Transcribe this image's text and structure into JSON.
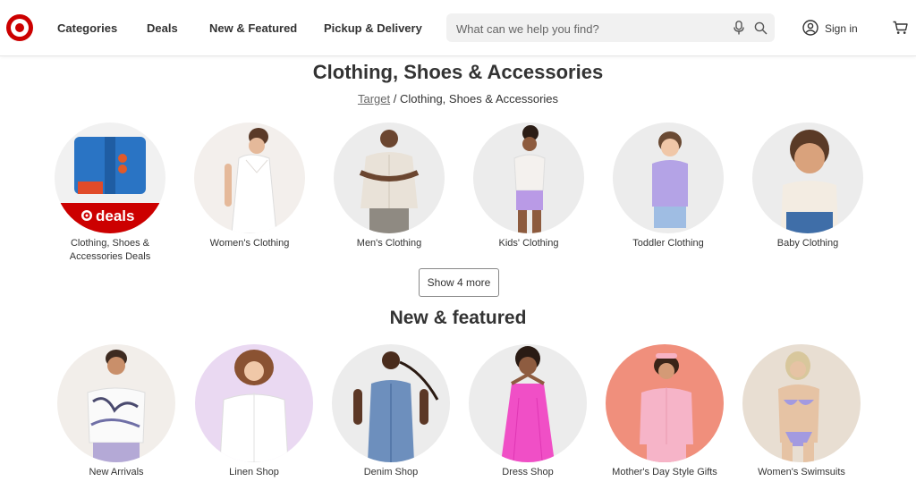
{
  "header": {
    "nav": [
      "Categories",
      "Deals",
      "New & Featured",
      "Pickup & Delivery"
    ],
    "search_placeholder": "What can we help you find?",
    "sign_in": "Sign in",
    "brand_color": "#cc0000"
  },
  "page": {
    "title": "Clothing, Shoes & Accessories",
    "breadcrumb": {
      "home": "Target",
      "separator": "/",
      "current": "Clothing, Shoes & Accessories"
    }
  },
  "categories": [
    {
      "label": "Clothing, Shoes & Accessories Deals",
      "badge": "deals"
    },
    {
      "label": "Women's Clothing"
    },
    {
      "label": "Men's Clothing"
    },
    {
      "label": "Kids' Clothing"
    },
    {
      "label": "Toddler Clothing"
    },
    {
      "label": "Baby Clothing"
    }
  ],
  "show_more": "Show 4 more",
  "featured": {
    "title": "New & featured",
    "items": [
      {
        "label": "New Arrivals"
      },
      {
        "label": "Linen Shop"
      },
      {
        "label": "Denim Shop"
      },
      {
        "label": "Dress Shop"
      },
      {
        "label": "Mother's Day Style Gifts"
      },
      {
        "label": "Women's Swimsuits"
      }
    ]
  }
}
